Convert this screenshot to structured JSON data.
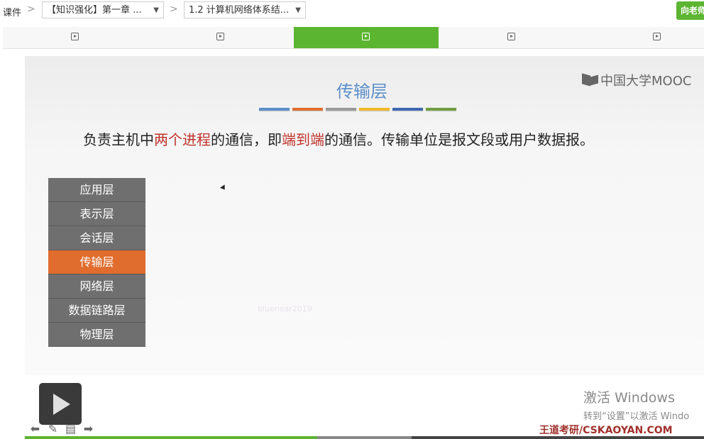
{
  "breadcrumb": {
    "root": "课件",
    "sep": ">",
    "chapter": "【知识强化】第一章 ...",
    "section": "1.2 计算机网络体系结...",
    "ask_button": "向老师提问"
  },
  "unit_tabs": [
    {
      "icon": "play-square-icon",
      "active": false
    },
    {
      "icon": "play-square-icon",
      "active": false
    },
    {
      "icon": "play-square-icon",
      "active": true
    },
    {
      "icon": "play-square-icon",
      "active": false
    },
    {
      "icon": "play-square-icon",
      "active": false
    }
  ],
  "slide": {
    "title": "传输层",
    "logo": "中国大学MOOC",
    "color_bars": [
      "#5b8fc7",
      "#e06d2d",
      "#9a9a9a",
      "#f0b829",
      "#3d67b2",
      "#6ea040"
    ],
    "desc_parts": [
      {
        "text": "负责主机中",
        "hl": false
      },
      {
        "text": "两个进程",
        "hl": true
      },
      {
        "text": "的通信，即",
        "hl": false
      },
      {
        "text": "端到端",
        "hl": true
      },
      {
        "text": "的通信。传输单位是报文段或用户数据报。",
        "hl": false
      }
    ],
    "layers": [
      "应用层",
      "表示层",
      "会话层",
      "传输层",
      "网络层",
      "数据链路层",
      "物理层"
    ],
    "active_layer": "传输层",
    "watermark": "bluenear2019"
  },
  "windows_activation": {
    "line1": "激活 Windows",
    "line2": "转到“设置”以激活 Windo"
  },
  "brand": "王道考研/CSKAOYAN.COM",
  "video": {
    "played_fraction": 0.43,
    "buffered_fraction": 0.57
  },
  "colors": {
    "accent": "#5cb531",
    "highlight": "#c0322c",
    "active_layer": "#e06d2d"
  }
}
